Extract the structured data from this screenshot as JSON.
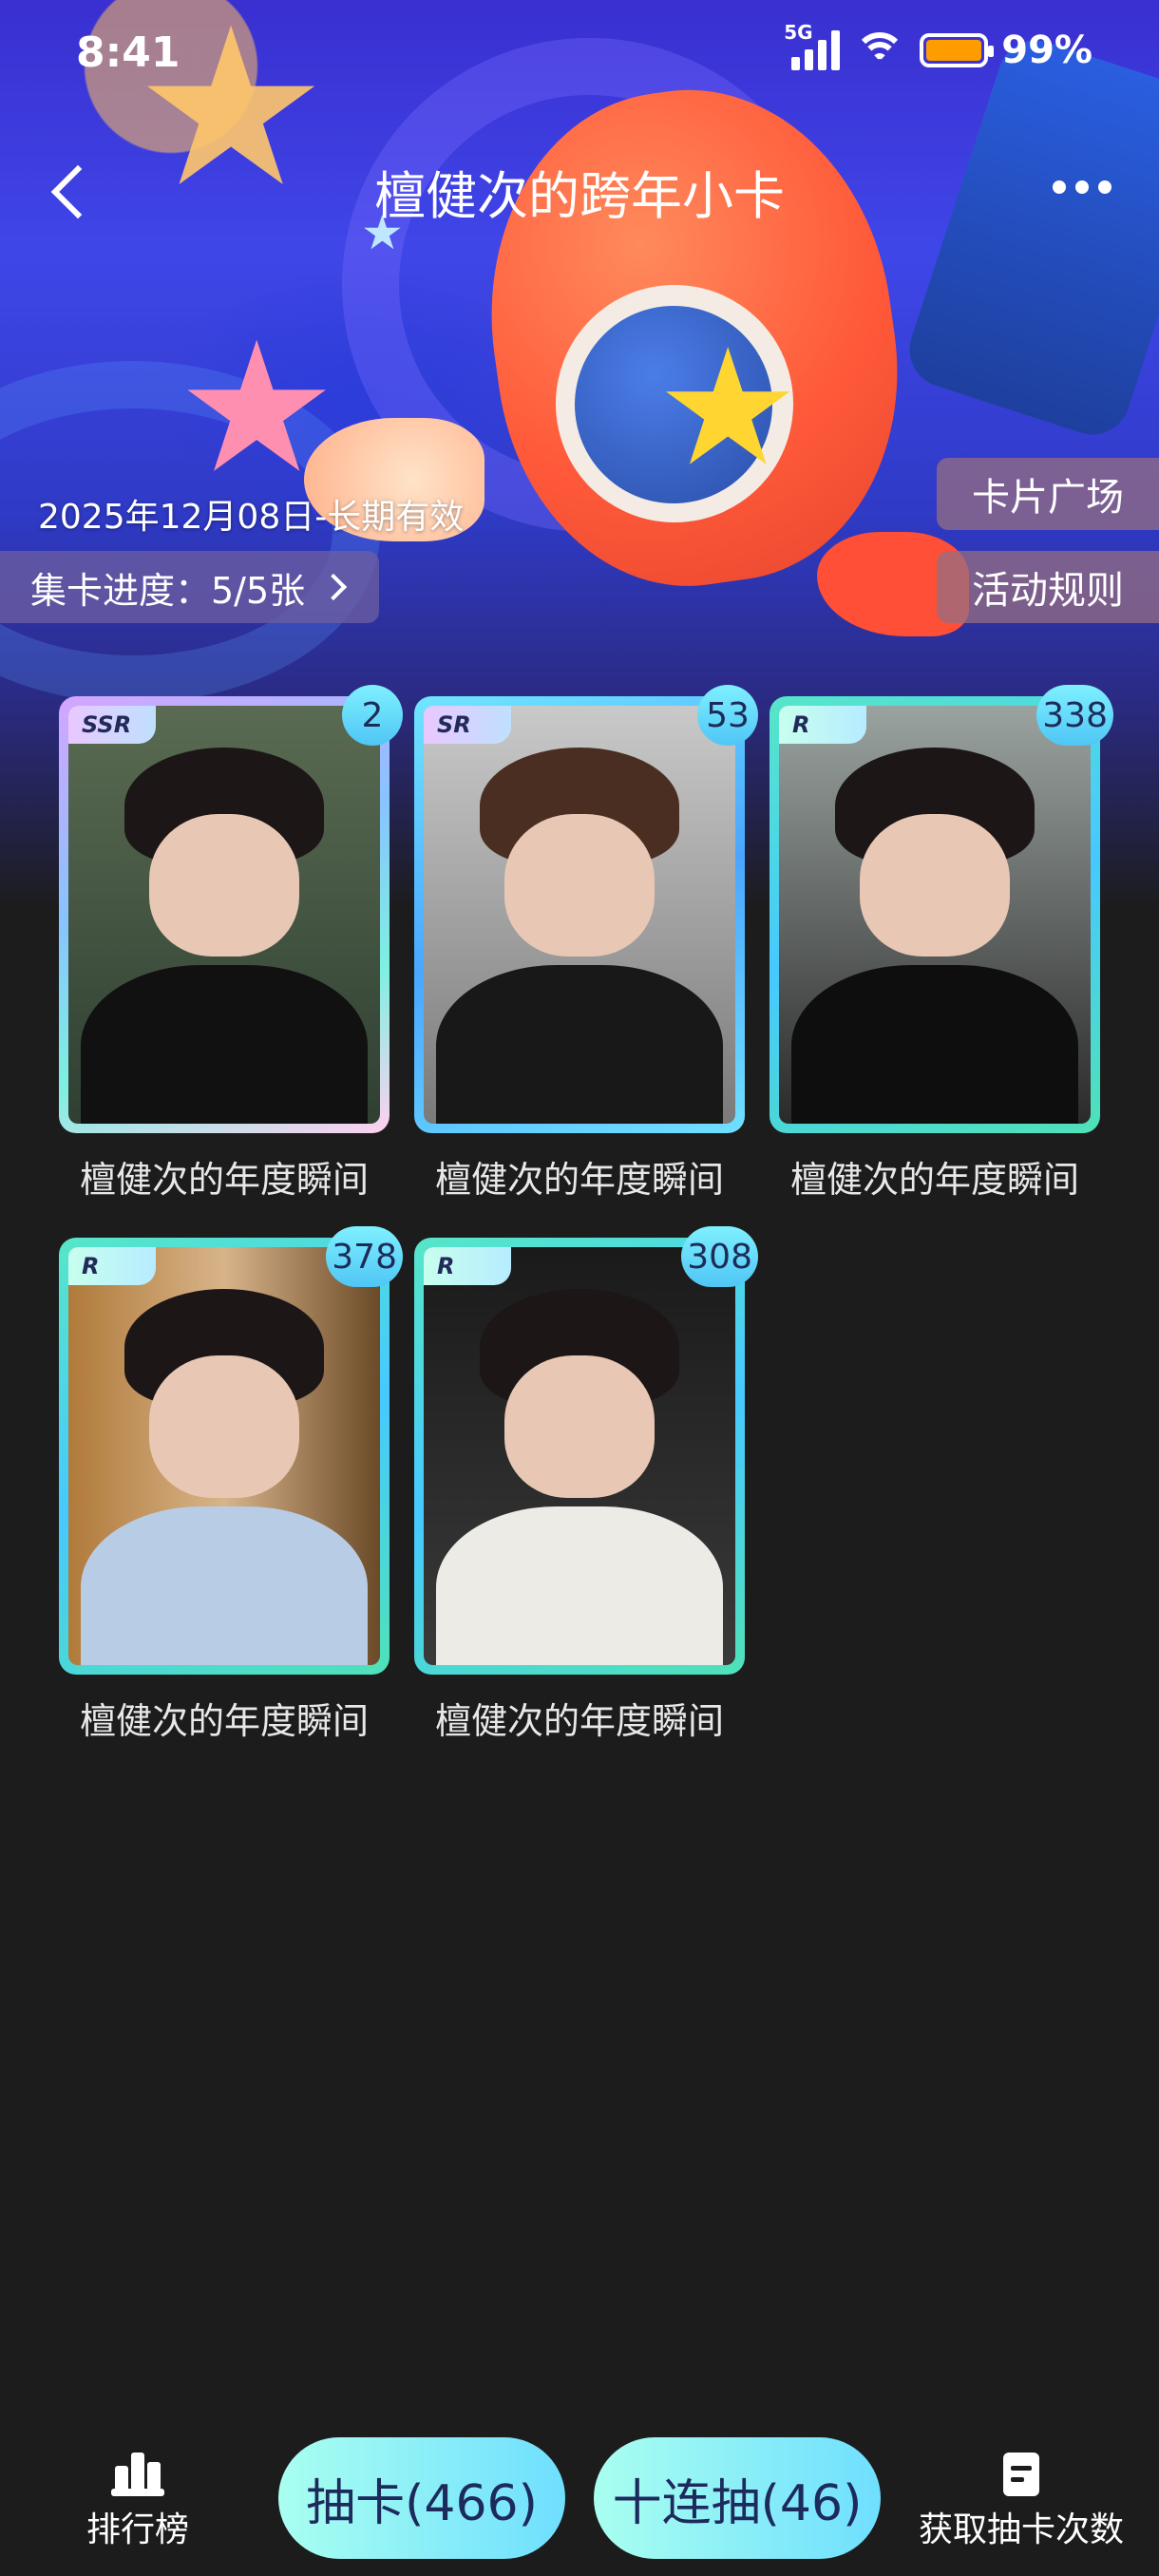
{
  "status_bar": {
    "time": "8:41",
    "network": "5G",
    "battery": "99%"
  },
  "header": {
    "title": "檀健次的跨年小卡"
  },
  "event": {
    "validity": "2025年12月08日-长期有效",
    "progress_label": "集卡进度：5/5张"
  },
  "side_buttons": {
    "plaza": "卡片广场",
    "rules": "活动规则"
  },
  "cards": [
    {
      "rarity": "SSR",
      "count": "2",
      "name": "檀健次的年度瞬间"
    },
    {
      "rarity": "SR",
      "count": "53",
      "name": "檀健次的年度瞬间"
    },
    {
      "rarity": "R",
      "count": "338",
      "name": "檀健次的年度瞬间"
    },
    {
      "rarity": "R",
      "count": "378",
      "name": "檀健次的年度瞬间"
    },
    {
      "rarity": "R",
      "count": "308",
      "name": "檀健次的年度瞬间"
    }
  ],
  "bottom_bar": {
    "ranking": "排行榜",
    "draw_one": "抽卡(466)",
    "draw_ten": "十连抽(46)",
    "obtain_draws": "获取抽卡次数"
  },
  "colors": {
    "accent_cyan": "#6fdfff",
    "battery": "#ff9d00",
    "background": "#1c1c1c"
  }
}
